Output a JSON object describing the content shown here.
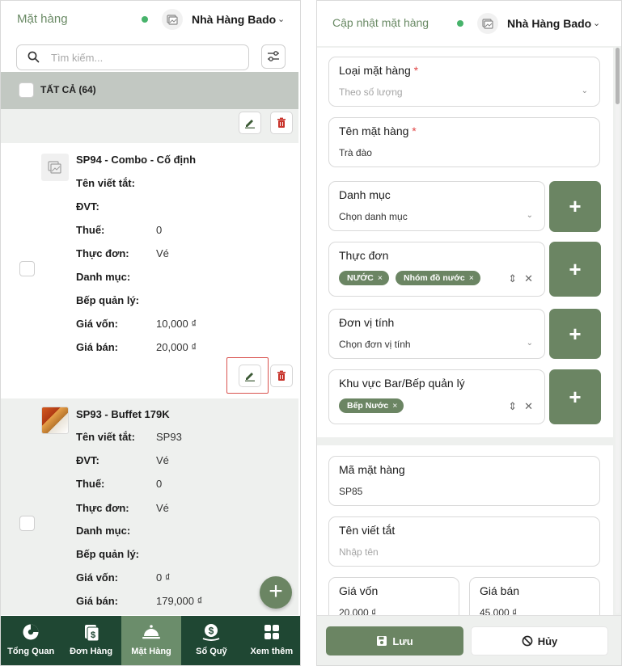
{
  "left_panel": {
    "header": {
      "title": "Mặt hàng",
      "shop_name": "Nhà Hàng Bado"
    },
    "search": {
      "placeholder": "Tìm kiếm..."
    },
    "select_all_label": "TẤT CẢ (64)",
    "items": [
      {
        "name": "SP94 - Combo - Cố định",
        "fields": [
          {
            "label": "Tên viết tắt:",
            "value": ""
          },
          {
            "label": "ĐVT:",
            "value": ""
          },
          {
            "label": "Thuế:",
            "value": "0"
          },
          {
            "label": "Thực đơn:",
            "value": "Vé"
          },
          {
            "label": "Danh mục:",
            "value": ""
          },
          {
            "label": "Bếp quản lý:",
            "value": ""
          },
          {
            "label": "Giá vốn:",
            "value": "10,000 ₫"
          },
          {
            "label": "Giá bán:",
            "value": "20,000 ₫"
          }
        ]
      },
      {
        "name": "SP93 - Buffet 179K",
        "fields": [
          {
            "label": "Tên viết tắt:",
            "value": "SP93"
          },
          {
            "label": "ĐVT:",
            "value": "Vé"
          },
          {
            "label": "Thuế:",
            "value": "0"
          },
          {
            "label": "Thực đơn:",
            "value": "Vé"
          },
          {
            "label": "Danh mục:",
            "value": ""
          },
          {
            "label": "Bếp quản lý:",
            "value": ""
          },
          {
            "label": "Giá vốn:",
            "value": "0 ₫"
          },
          {
            "label": "Giá bán:",
            "value": "179,000 ₫"
          }
        ]
      }
    ],
    "bottom_nav": [
      {
        "label": "Tổng Quan",
        "icon": "pie-chart-icon",
        "active": false
      },
      {
        "label": "Đơn Hàng",
        "icon": "money-bill-icon",
        "active": false
      },
      {
        "label": "Mặt Hàng",
        "icon": "cloche-icon",
        "active": true
      },
      {
        "label": "Sổ Quỹ",
        "icon": "coin-dollar-icon",
        "active": false
      },
      {
        "label": "Xem thêm",
        "icon": "grid-apps-icon",
        "active": false
      }
    ]
  },
  "right_panel": {
    "header": {
      "title": "Cập nhật mặt hàng",
      "shop_name": "Nhà Hàng Bado"
    },
    "form": {
      "item_type": {
        "label": "Loại mặt hàng",
        "required": "*",
        "value": "Theo số lượng"
      },
      "item_name": {
        "label": "Tên mặt hàng",
        "required": "*",
        "value": "Trà đào"
      },
      "category": {
        "label": "Danh mục",
        "placeholder": "Chọn danh mục"
      },
      "menu": {
        "label": "Thực đơn",
        "tags": [
          "NƯỚC",
          "Nhóm đồ nước"
        ]
      },
      "unit": {
        "label": "Đơn vị tính",
        "placeholder": "Chọn đơn vị tính"
      },
      "kitchen_area": {
        "label": "Khu vực Bar/Bếp quản lý",
        "tags": [
          "Bếp Nước"
        ]
      },
      "item_code": {
        "label": "Mã mặt hàng",
        "value": "SP85"
      },
      "short_name": {
        "label": "Tên viết tắt",
        "placeholder": "Nhập tên"
      },
      "cost_price": {
        "label": "Giá vốn",
        "value": "20,000 ₫"
      },
      "sale_price": {
        "label": "Giá bán",
        "value": "45,000 ₫"
      }
    },
    "footer": {
      "save_label": "Lưu",
      "cancel_label": "Hủy"
    }
  },
  "colors": {
    "primary": "#6b8563",
    "nav_background": "#1f4733",
    "nav_active": "#6b8d6b",
    "online_dot": "#47b36b",
    "delete_red": "#c8342c",
    "highlight_border": "#d9534f"
  }
}
